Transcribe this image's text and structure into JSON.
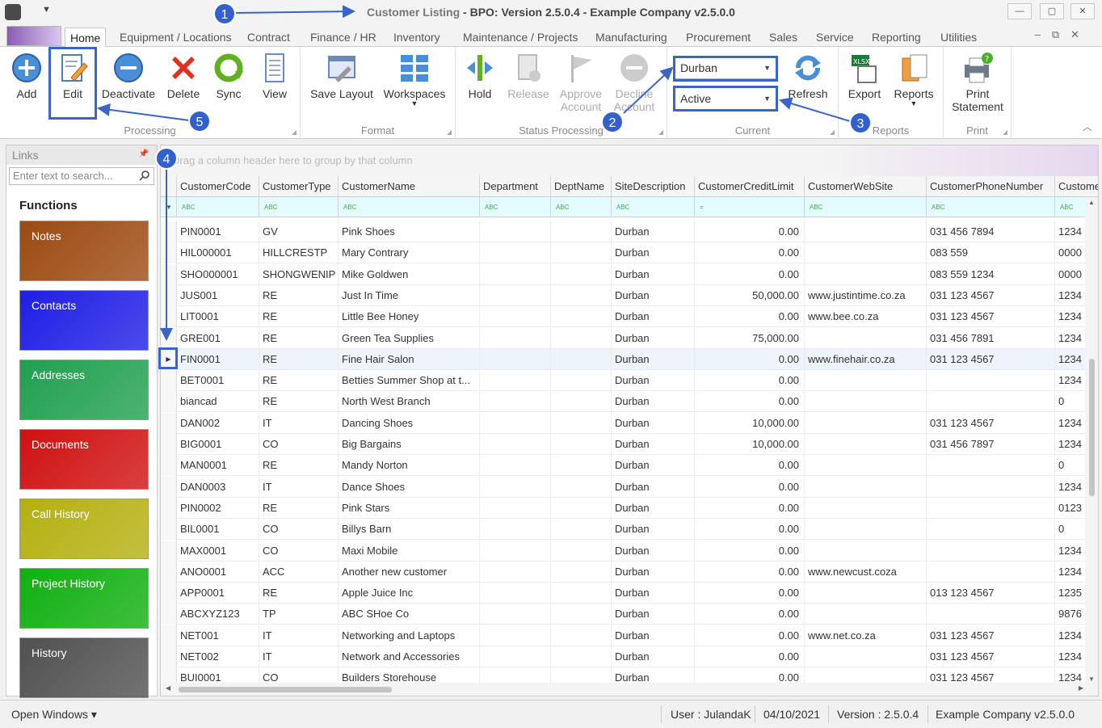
{
  "window": {
    "title_prefix": "Customer Listing",
    "title_rest": " - BPO: Version 2.5.0.4 - Example Company v2.5.0.0",
    "min": "—",
    "max": "▢",
    "close": "✕"
  },
  "menu": {
    "tabs": [
      "Home",
      "Equipment / Locations",
      "Contract",
      "Finance / HR",
      "Inventory",
      "Maintenance / Projects",
      "Manufacturing",
      "Procurement",
      "Sales",
      "Service",
      "Reporting",
      "Utilities"
    ],
    "active": "Home"
  },
  "ribbon": {
    "processing": {
      "label": "Processing",
      "add": "Add",
      "edit": "Edit",
      "deactivate": "Deactivate",
      "delete": "Delete",
      "sync": "Sync",
      "view": "View"
    },
    "format": {
      "label": "Format",
      "save_layout": "Save Layout",
      "workspaces": "Workspaces"
    },
    "status": {
      "label": "Status Processing",
      "hold": "Hold",
      "release": "Release",
      "approve1": "Approve",
      "approve2": "Account",
      "decline1": "Decline",
      "decline2": "Account"
    },
    "current": {
      "label": "Current",
      "site": "Durban",
      "status": "Active",
      "refresh": "Refresh"
    },
    "reports": {
      "label": "Reports",
      "export": "Export",
      "reports": "Reports"
    },
    "print": {
      "label": "Print",
      "line1": "Print",
      "line2": "Statement"
    }
  },
  "links": {
    "title": "Links",
    "search_placeholder": "Enter text to search...",
    "functions_title": "Functions",
    "buttons": [
      {
        "label": "Notes",
        "color": "#9c4a10"
      },
      {
        "label": "Contacts",
        "color": "#1e1ee6"
      },
      {
        "label": "Addresses",
        "color": "#20a050"
      },
      {
        "label": "Documents",
        "color": "#d01010"
      },
      {
        "label": "Call History",
        "color": "#b4b010"
      },
      {
        "label": "Project History",
        "color": "#10b010"
      },
      {
        "label": "History",
        "color": "#505050"
      }
    ]
  },
  "grid": {
    "group_hint": "Drag a column header here to group by that column",
    "columns": [
      "CustomerCode",
      "CustomerType",
      "CustomerName",
      "Department",
      "DeptName",
      "SiteDescription",
      "CustomerCreditLimit",
      "CustomerWebSite",
      "CustomerPhoneNumber",
      "Custome"
    ],
    "filter_marks": [
      "ABC",
      "ABC",
      "ABC",
      "ABC",
      "ABC",
      "ABC",
      "=",
      "ABC",
      "ABC",
      "ABC"
    ],
    "selected_index": 6,
    "rows": [
      [
        "PIN0001",
        "GV",
        "Pink Shoes",
        "",
        "",
        "Durban",
        "0.00",
        "",
        "031 456 7894",
        "1234"
      ],
      [
        "HIL000001",
        "HILLCRESTP",
        "Mary Contrary",
        "",
        "",
        "Durban",
        "0.00",
        "",
        "083 559",
        "0000"
      ],
      [
        "SHO000001",
        "SHONGWENIP",
        "Mike Goldwen",
        "",
        "",
        "Durban",
        "0.00",
        "",
        "083 559 1234",
        "0000"
      ],
      [
        "JUS001",
        "RE",
        "Just In Time",
        "",
        "",
        "Durban",
        "50,000.00",
        "www.justintime.co.za",
        "031 123 4567",
        "1234"
      ],
      [
        "LIT0001",
        "RE",
        "Little Bee Honey",
        "",
        "",
        "Durban",
        "0.00",
        "www.bee.co.za",
        "031 123 4567",
        "1234"
      ],
      [
        "GRE001",
        "RE",
        "Green Tea Supplies",
        "",
        "",
        "Durban",
        "75,000.00",
        "",
        "031 456 7891",
        "1234"
      ],
      [
        "FIN0001",
        "RE",
        "Fine Hair Salon",
        "",
        "",
        "Durban",
        "0.00",
        "www.finehair.co.za",
        "031 123 4567",
        "1234"
      ],
      [
        "BET0001",
        "RE",
        "Betties Summer Shop at t...",
        "",
        "",
        "Durban",
        "0.00",
        "",
        "",
        "1234"
      ],
      [
        "biancad",
        "RE",
        "North West Branch",
        "",
        "",
        "Durban",
        "0.00",
        "",
        "",
        "0"
      ],
      [
        "DAN002",
        "IT",
        "Dancing Shoes",
        "",
        "",
        "Durban",
        "10,000.00",
        "",
        "031 123 4567",
        "1234"
      ],
      [
        "BIG0001",
        "CO",
        "Big Bargains",
        "",
        "",
        "Durban",
        "10,000.00",
        "",
        "031 456 7897",
        "1234"
      ],
      [
        "MAN0001",
        "RE",
        "Mandy Norton",
        "",
        "",
        "Durban",
        "0.00",
        "",
        "",
        "0"
      ],
      [
        "DAN0003",
        "IT",
        "Dance Shoes",
        "",
        "",
        "Durban",
        "0.00",
        "",
        "",
        "1234"
      ],
      [
        "PIN0002",
        "RE",
        "Pink Stars",
        "",
        "",
        "Durban",
        "0.00",
        "",
        "",
        "0123"
      ],
      [
        "BIL0001",
        "CO",
        "Billys Barn",
        "",
        "",
        "Durban",
        "0.00",
        "",
        "",
        "0"
      ],
      [
        "MAX0001",
        "CO",
        "Maxi Mobile",
        "",
        "",
        "Durban",
        "0.00",
        "",
        "",
        "1234"
      ],
      [
        "ANO0001",
        "ACC",
        "Another new customer",
        "",
        "",
        "Durban",
        "0.00",
        "www.newcust.coza",
        "",
        "1234"
      ],
      [
        "APP0001",
        "RE",
        "Apple Juice Inc",
        "",
        "",
        "Durban",
        "0.00",
        "",
        "013 123 4567",
        "1235"
      ],
      [
        "ABCXYZ123",
        "TP",
        "ABC SHoe Co",
        "",
        "",
        "Durban",
        "0.00",
        "",
        "",
        "9876"
      ],
      [
        "NET001",
        "IT",
        "Networking and Laptops",
        "",
        "",
        "Durban",
        "0.00",
        "www.net.co.za",
        "031 123 4567",
        "1234"
      ],
      [
        "NET002",
        "IT",
        "Network and Accessories",
        "",
        "",
        "Durban",
        "0.00",
        "",
        "031 123 4567",
        "1234"
      ],
      [
        "BUI0001",
        "CO",
        "Builders Storehouse",
        "",
        "",
        "Durban",
        "0.00",
        "",
        "031 123 4567",
        "1234"
      ]
    ]
  },
  "status": {
    "open_windows": "Open Windows ▾",
    "user": "User : JulandaK",
    "date": "04/10/2021",
    "version": "Version : 2.5.0.4",
    "company": "Example Company v2.5.0.0"
  },
  "annotations": [
    "1",
    "2",
    "3",
    "4",
    "5"
  ]
}
